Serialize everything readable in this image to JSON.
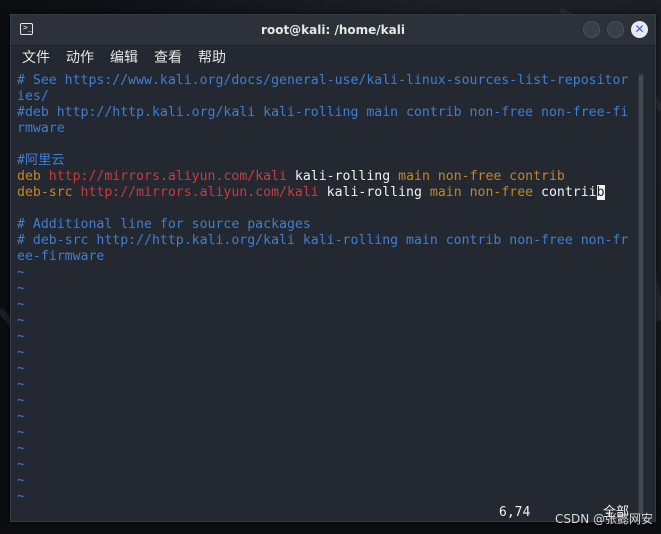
{
  "window": {
    "title": "root@kali: /home/kali",
    "close_glyph": "✕"
  },
  "menu": [
    "文件",
    "动作",
    "编辑",
    "查看",
    "帮助"
  ],
  "lines": {
    "l1": "# See https://www.kali.org/docs/general-use/kali-linux-sources-list-repositor",
    "l2": "ies/",
    "l3": "#deb http://http.kali.org/kali kali-rolling main contrib non-free non-free-fi",
    "l4": "rmware",
    "l5": "#阿里云",
    "l6": {
      "a": "deb",
      "b": " http://mirrors.aliyun.com/kali",
      "c": " kali-rolling",
      "d": " main non-free contrib"
    },
    "l7": {
      "a": "deb-src",
      "b": " http://mirrors.aliyun.com/kali",
      "c": " kali-rolling",
      "d": " main non-free",
      "e": " contrii",
      "cursor": "b"
    },
    "l8": "# Additional line for source packages",
    "l9": "# deb-src http://http.kali.org/kali kali-rolling main contrib non-free non-fr",
    "l10": "ee-firmware"
  },
  "tilde": "~",
  "status": {
    "position": "6,74",
    "scope": "全部"
  },
  "watermark": "CSDN @张懿网安",
  "colors": {
    "comment": "#3e7fd4",
    "url": "#d23a3a",
    "keyword": "#c7851f",
    "text": "#f2f2f2",
    "background": "#232831"
  }
}
